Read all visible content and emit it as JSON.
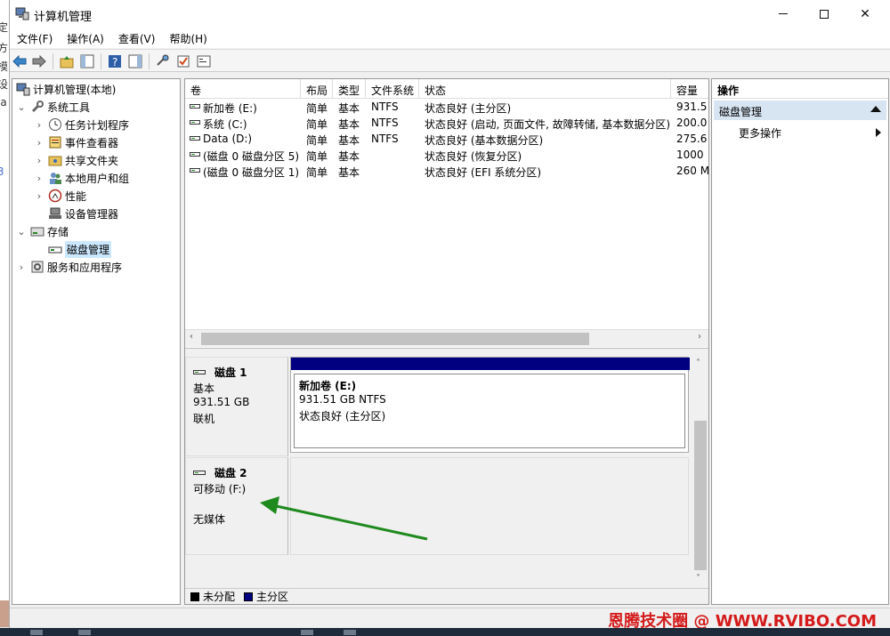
{
  "window": {
    "title": "计算机管理"
  },
  "menu": [
    "文件(F)",
    "操作(A)",
    "查看(V)",
    "帮助(H)"
  ],
  "tree": {
    "root": "计算机管理(本地)",
    "system_tools": "系统工具",
    "task_scheduler": "任务计划程序",
    "event_viewer": "事件查看器",
    "shared_folders": "共享文件夹",
    "local_users": "本地用户和组",
    "performance": "性能",
    "device_manager": "设备管理器",
    "storage": "存储",
    "disk_management": "磁盘管理",
    "services": "服务和应用程序"
  },
  "volumes": {
    "headers": [
      "卷",
      "布局",
      "类型",
      "文件系统",
      "状态",
      "容量"
    ],
    "rows": [
      [
        "新加卷 (E:)",
        "简单",
        "基本",
        "NTFS",
        "状态良好 (主分区)",
        "931.5"
      ],
      [
        "系统 (C:)",
        "简单",
        "基本",
        "NTFS",
        "状态良好 (启动, 页面文件, 故障转储, 基本数据分区)",
        "200.0"
      ],
      [
        "Data (D:)",
        "简单",
        "基本",
        "NTFS",
        "状态良好 (基本数据分区)",
        "275.6"
      ],
      [
        "(磁盘 0 磁盘分区 5)",
        "简单",
        "基本",
        "",
        "状态良好 (恢复分区)",
        "1000"
      ],
      [
        "(磁盘 0 磁盘分区 1)",
        "简单",
        "基本",
        "",
        "状态良好 (EFI 系统分区)",
        "260 M"
      ]
    ]
  },
  "disks": {
    "disk1": {
      "name": "磁盘 1",
      "type": "基本",
      "size": "931.51 GB",
      "status": "联机",
      "partition": {
        "name": "新加卷  (E:)",
        "size": "931.51 GB NTFS",
        "status": "状态良好 (主分区)"
      }
    },
    "disk2": {
      "name": "磁盘 2",
      "type": "可移动 (F:)",
      "media": "无媒体"
    }
  },
  "legend": {
    "unallocated": "未分配",
    "primary": "主分区"
  },
  "actions": {
    "header": "操作",
    "section": "磁盘管理",
    "more": "更多操作"
  },
  "watermark": "恩腾技术圈 @ WWW.RVIBO.COM",
  "colors": {
    "primary_partition": "#000080",
    "unallocated": "#000000",
    "arrow": "#1e8a1e",
    "watermark": "#d41a1a"
  }
}
